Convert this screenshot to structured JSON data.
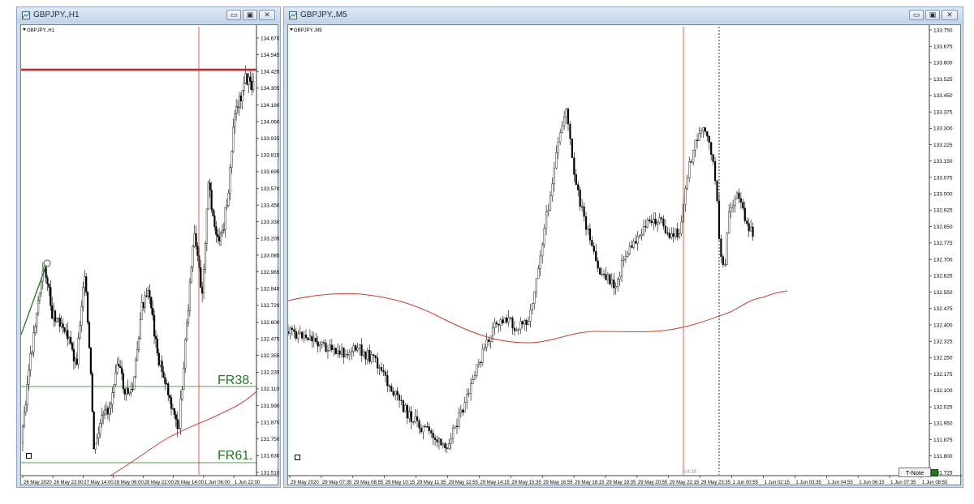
{
  "left_window": {
    "title": "GBPJPY.,H1",
    "symbol_label": "GBPJPY.,H1",
    "price_ticks": [
      "134.670",
      "134.545",
      "134.425",
      "134.305",
      "134.180",
      "134.060",
      "133.935",
      "133.815",
      "133.695",
      "133.570",
      "133.450",
      "133.330",
      "133.205",
      "133.085",
      "132.965",
      "132.840",
      "132.720",
      "132.600",
      "132.475",
      "132.355",
      "132.235",
      "132.110",
      "131.990",
      "131.870",
      "131.750",
      "131.630",
      "131.510"
    ],
    "time_ticks": [
      "26 May 2020",
      "26 May 22:00",
      "27 May 14:00",
      "28 May 06:00",
      "28 May 22:00",
      "29 May 14:00",
      "1 Jun 06:00",
      "1 Jun 22:00"
    ],
    "fib_labels": [
      "FR38.",
      "FR61."
    ],
    "colors": {
      "horizontal_level": "#d62020",
      "fib_lines": "#1f7a1f",
      "ma": "#c8412c",
      "vline": "#c8412c"
    }
  },
  "right_window": {
    "title": "GBPJPY.,M5",
    "symbol_label": "GBPJPY.,M5",
    "price_ticks": [
      "133.750",
      "133.675",
      "133.600",
      "133.525",
      "133.450",
      "133.375",
      "133.300",
      "133.225",
      "133.150",
      "133.075",
      "133.000",
      "132.925",
      "132.850",
      "132.775",
      "132.700",
      "132.625",
      "132.550",
      "132.475",
      "132.400",
      "132.325",
      "132.250",
      "132.175",
      "132.100",
      "132.025",
      "131.950",
      "131.875",
      "131.800",
      "131.725"
    ],
    "time_ticks": [
      "29 May 2020",
      "29 May 07:35",
      "29 May 08:55",
      "29 May 10:15",
      "29 May 11:35",
      "29 May 12:55",
      "29 May 14:15",
      "29 May 15:35",
      "29 May 16:55",
      "29 May 18:15",
      "29 May 19:35",
      "29 May 20:55",
      "29 May 22:15",
      "29 May 23:35",
      "1 Jun 00:55",
      "1 Jun 02:15",
      "1 Jun 03:35",
      "1 Jun 04:55",
      "1 Jun 06:15",
      "1 Jun 07:35",
      "1 Jun 08:55"
    ],
    "vline_time_label": "04:35",
    "tnote_label": "T-Note"
  },
  "controls": {
    "minimize": "▭",
    "maximize": "▣",
    "close": "✕"
  }
}
